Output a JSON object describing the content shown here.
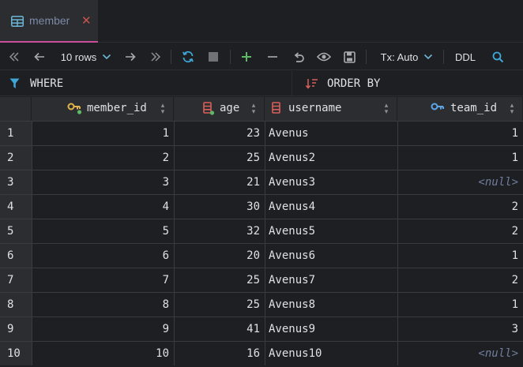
{
  "tab": {
    "title": "member",
    "close": "✕"
  },
  "toolbar": {
    "rows_label": "10 rows",
    "tx_label": "Tx: Auto",
    "ddl_label": "DDL"
  },
  "filter": {
    "where_label": "WHERE",
    "orderby_label": "ORDER BY"
  },
  "columns": [
    {
      "name": "member_id",
      "icon": "primary-key-icon"
    },
    {
      "name": "age",
      "icon": "column-icon"
    },
    {
      "name": "username",
      "icon": "column-icon"
    },
    {
      "name": "team_id",
      "icon": "foreign-key-icon"
    }
  ],
  "rows": [
    {
      "n": "1",
      "member_id": "1",
      "age": "23",
      "username": "Avenus",
      "team_id": "1"
    },
    {
      "n": "2",
      "member_id": "2",
      "age": "25",
      "username": "Avenus2",
      "team_id": "1"
    },
    {
      "n": "3",
      "member_id": "3",
      "age": "21",
      "username": "Avenus3",
      "team_id": "<null>"
    },
    {
      "n": "4",
      "member_id": "4",
      "age": "30",
      "username": "Avenus4",
      "team_id": "2"
    },
    {
      "n": "5",
      "member_id": "5",
      "age": "32",
      "username": "Avenus5",
      "team_id": "2"
    },
    {
      "n": "6",
      "member_id": "6",
      "age": "20",
      "username": "Avenus6",
      "team_id": "1"
    },
    {
      "n": "7",
      "member_id": "7",
      "age": "25",
      "username": "Avenus7",
      "team_id": "2"
    },
    {
      "n": "8",
      "member_id": "8",
      "age": "25",
      "username": "Avenus8",
      "team_id": "1"
    },
    {
      "n": "9",
      "member_id": "9",
      "age": "41",
      "username": "Avenus9",
      "team_id": "3"
    },
    {
      "n": "10",
      "member_id": "10",
      "age": "16",
      "username": "Avenus10",
      "team_id": "<null>"
    }
  ],
  "colors": {
    "accent": "#c94f9a",
    "key": "#e0b44a",
    "fk": "#5ea5e8",
    "column": "#d9605a",
    "add": "#5fb865",
    "refresh": "#3fa7d6",
    "null": "#6f7d9e"
  }
}
